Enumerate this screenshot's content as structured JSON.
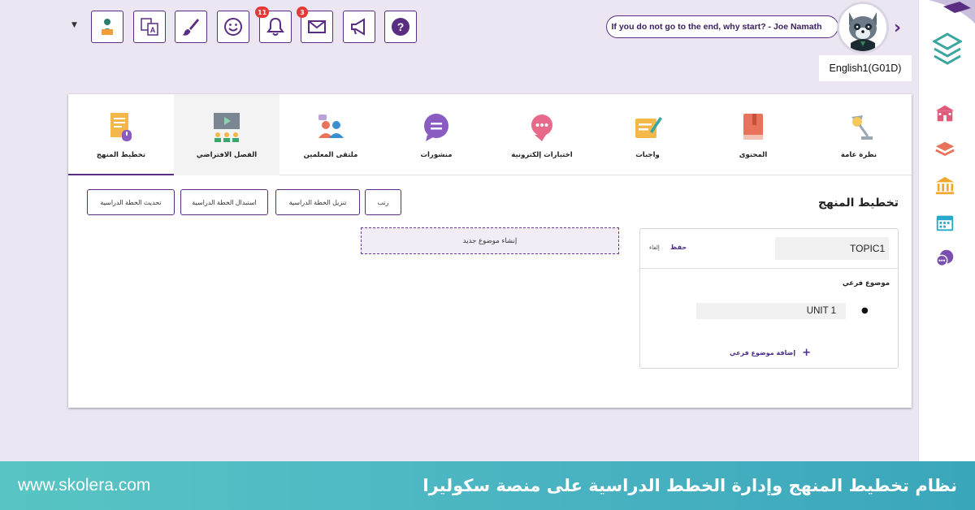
{
  "toolbar": {
    "notifications_badge": "11",
    "messages_badge": "3"
  },
  "header": {
    "quote": "If you do not go to the end, why start? - Joe Namath",
    "class_label": "English1(G01D)"
  },
  "tabs": [
    {
      "label": "نظرة عامة",
      "icon": "lamp-icon"
    },
    {
      "label": "المحتوى",
      "icon": "book-icon"
    },
    {
      "label": "واجبات",
      "icon": "homework-icon"
    },
    {
      "label": "اختبارات إلكترونية",
      "icon": "quiz-icon"
    },
    {
      "label": "منشورات",
      "icon": "chat-bubble-icon"
    },
    {
      "label": "ملتقى المعلمين",
      "icon": "teachers-icon"
    },
    {
      "label": "الفصل الافتراضي",
      "icon": "virtual-class-icon"
    },
    {
      "label": "تخطيط المنهج",
      "icon": "curriculum-plan-icon"
    }
  ],
  "page": {
    "title": "تخطيط المنهج",
    "buttons": {
      "sort": "رتب",
      "download": "تنزيل الخطة الدراسية",
      "replace": "استبدال الخطة الدراسية",
      "update": "تحديث الخطة الدراسية"
    },
    "new_topic": "إنشاء موضوع جديد"
  },
  "topic": {
    "name": "TOPIC1",
    "save": "حفظ",
    "cancel": "إلغاء",
    "subtopic_heading": "موضوع فرعي",
    "unit": "UNIT 1",
    "add_subtopic": "إضافة موضوع فرعي"
  },
  "banner": {
    "url": "www.skolera.com",
    "title": "نظام تخطيط المنهج وإدارة الخطط الدراسية على منصة سكوليرا"
  },
  "colors": {
    "primary": "#5a2d82",
    "banner": "#4fb8c4",
    "badge": "#e53935"
  }
}
